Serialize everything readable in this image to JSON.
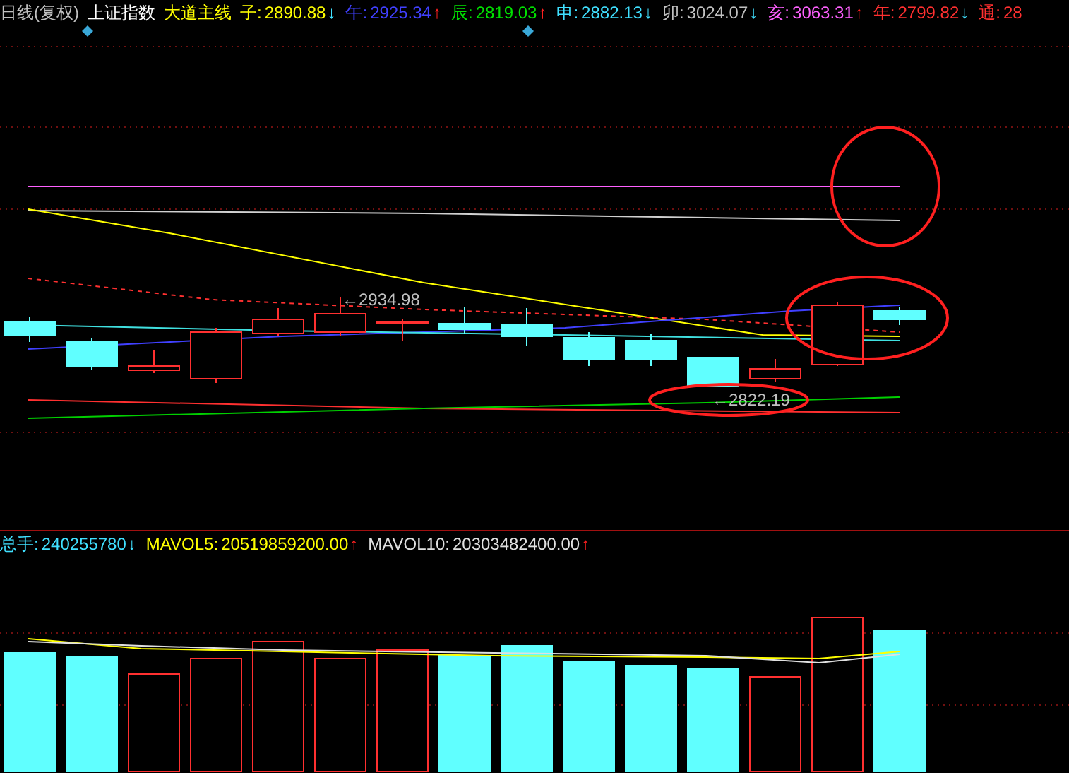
{
  "header": {
    "period": "日线(复权)",
    "symbol": "上证指数",
    "indicator": "大道主线",
    "values": [
      {
        "label": "子:",
        "value": "2890.88",
        "arrow": "↓",
        "rising": false,
        "color": "#ffff00"
      },
      {
        "label": "午:",
        "value": "2925.34",
        "arrow": "↑",
        "rising": true,
        "color": "#4040ff"
      },
      {
        "label": "辰:",
        "value": "2819.03",
        "arrow": "↑",
        "rising": true,
        "color": "#00e000"
      },
      {
        "label": "申:",
        "value": "2882.13",
        "arrow": "↓",
        "rising": false,
        "color": "#40e0ff"
      },
      {
        "label": "卯:",
        "value": "3024.07",
        "arrow": "↓",
        "rising": false,
        "color": "#c0c0c0"
      },
      {
        "label": "亥:",
        "value": "3063.31",
        "arrow": "↑",
        "rising": true,
        "color": "#ff60ff"
      },
      {
        "label": "年:",
        "value": "2799.82",
        "arrow": "↓",
        "rising": false,
        "color": "#ff3030"
      },
      {
        "label": "通:",
        "value": "28",
        "color": "#ff3030"
      }
    ]
  },
  "price_chart": {
    "high_label": "←2934.98",
    "low_label": "←2822.19"
  },
  "volume_header": [
    {
      "label": "总手:",
      "value": "240255780",
      "arrow": "↓",
      "rising": false,
      "color": "#40e0ff"
    },
    {
      "label": "MAVOL5:",
      "value": "20519859200.00",
      "arrow": "↑",
      "rising": true,
      "color": "#ffff00"
    },
    {
      "label": "MAVOL10:",
      "value": "20303482400.00",
      "arrow": "↑",
      "rising": true,
      "color": "#e0e0e0"
    }
  ]
}
